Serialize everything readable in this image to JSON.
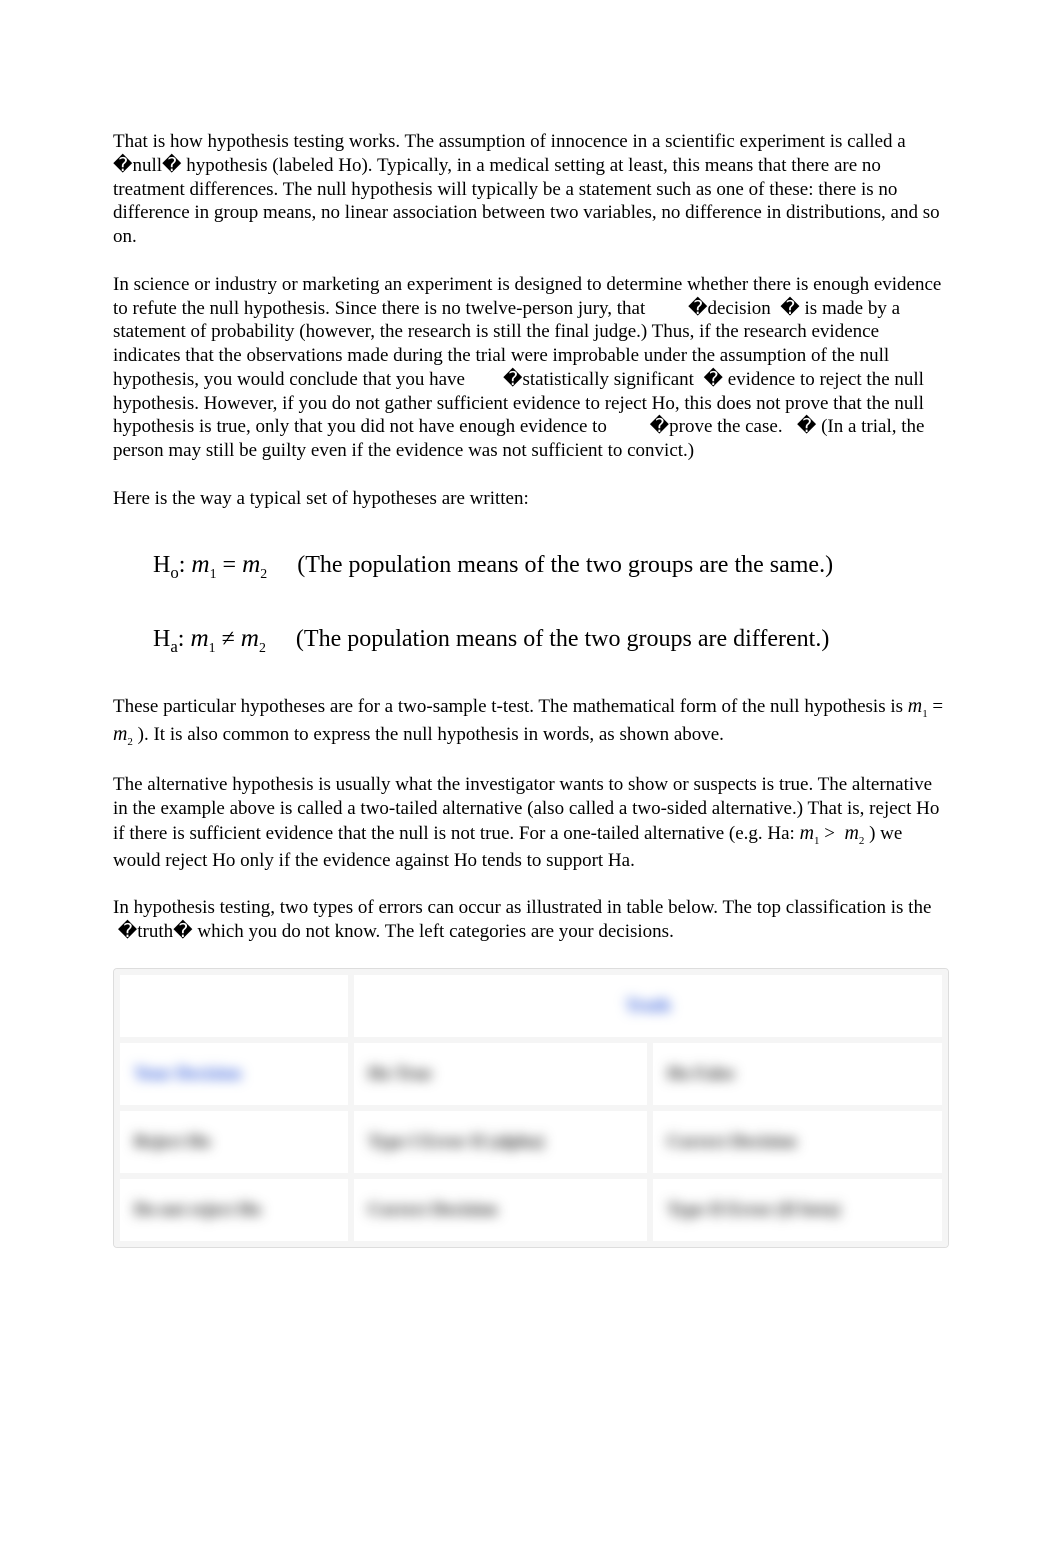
{
  "para1": {
    "t1": "That is how hypothesis testing works. The assumption of innocence in a scientific experiment is called a ",
    "d1": "�",
    "t2": "null",
    "d2": "�",
    "t3": " hypothesis (labeled Ho). Typically, in a medical setting at least, this means that there are no treatment differences. The null hypothesis will typically be a statement such as one of these: there is no difference in group means, no linear association between two variables, no difference in distributions, and so on."
  },
  "para2": {
    "t1": "In science or industry or marketing an experiment is designed to determine whether there is enough evidence to refute the null hypothesis. Since there is no twelve-person jury, that ",
    "d1": "�",
    "t2": "decision",
    "d2": "�",
    "t3": " is made by a statement of probability (however, the research is still the final judge.) Thus, if the research evidence indicates that the observations made during the trial were improbable under the assumption of the null hypothesis, you would conclude that you have ",
    "d3": "�",
    "t4": "statistically significant",
    "d4": "�",
    "t5": " evidence to reject the null hypothesis. However, if you do not gather sufficient evidence to reject Ho, this does not prove that the null hypothesis is true, only that you did not have enough evidence to ",
    "d5": "�",
    "t6": "prove the case.",
    "d6": "�",
    "t7": " (In a trial, the person may still be guilty even if the evidence was not sufficient to convict.)"
  },
  "intro_hyp": "Here is the way a typical set of hypotheses are written:",
  "hyp_null": {
    "label": "H",
    "sub": "o",
    "colon": ": ",
    "m1": "m",
    "s1": "1",
    "op": " = ",
    "m2": "m",
    "s2": "2",
    "pad": "   ",
    "desc": "(The population means of the two groups are the same.)"
  },
  "hyp_alt": {
    "label": "H",
    "sub": "a",
    "colon": ": ",
    "m1": "m",
    "s1": "1",
    "op": " ≠ ",
    "m2": "m",
    "s2": "2",
    "pad": "   ",
    "desc": "(The population means of the two groups are different.)"
  },
  "para3": {
    "t1": "These particular hypotheses are for a two-sample t-test. The mathematical form of the null hypothesis is ",
    "m1": "m",
    "s1": "1",
    "op": " = ",
    "m2": "m",
    "s2": "2",
    "t2": " ). It is also common to express the null hypothesis in words, as shown above."
  },
  "para4": {
    "t1": "The alternative hypothesis is usually what the investigator wants to show or suspects is true. The alternative in the example above is called a two-tailed alternative (also called a two-sided alternative.) That is, reject Ho if there is sufficient evidence that the null is not true. For a one-tailed alternative (e.g. Ha: ",
    "m1": "m",
    "s1": "1",
    "op": " > ",
    "m2": "m",
    "s2": "2",
    "t2": " ) we would reject Ho only if the evidence against Ho tends to support Ha."
  },
  "para5": {
    "t1": "In hypothesis testing, two types of errors can occur as illustrated in table below. The top classification is the ",
    "d1": "�",
    "t2": "truth",
    "d2": "�",
    "t3": " which you do not know. The left categories are your decisions."
  },
  "table": {
    "header_truth": "Truth",
    "row_header_left": "Your Decision",
    "col_h0true": "Ho True",
    "col_h0false": "Ho False",
    "row_reject": "Reject Ho",
    "cell_reject_true": "Type I Error II (alpha)",
    "cell_reject_false": "Correct Decision",
    "row_notreject": "Do not reject Ho",
    "cell_notreject_true": "Correct Decision",
    "cell_notreject_false": "Type II Error (II beta)"
  }
}
